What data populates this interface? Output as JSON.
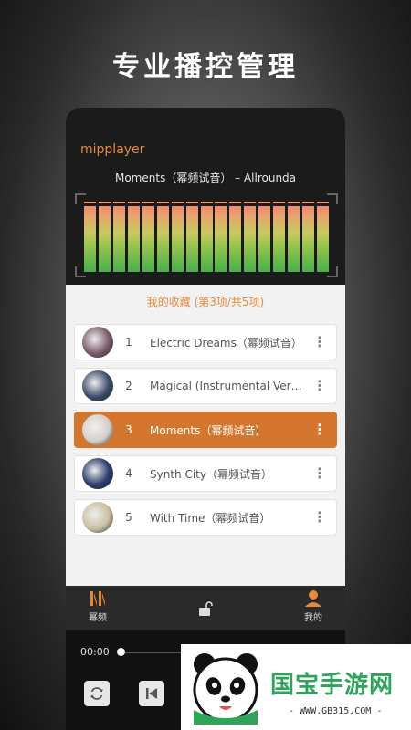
{
  "headline": "专业播控管理",
  "app": {
    "brand": "mipplayer",
    "now_playing": "Moments（幂频试音） – Allrounda"
  },
  "visualizer": {
    "levels": [
      0.92,
      0.92,
      0.92,
      0.92,
      0.92,
      0.92,
      0.92,
      0.92,
      0.92,
      0.92,
      0.92,
      0.92,
      0.92,
      0.92,
      0.92,
      0.92,
      0.92
    ]
  },
  "playlist": {
    "title": "我的收藏 (第3项/共5项)",
    "items": [
      {
        "num": "1",
        "name": "Electric Dreams（幂频试音）",
        "active": false,
        "thumb_color": "#7a5a6a"
      },
      {
        "num": "2",
        "name": "Magical (Instrumental Version)",
        "active": false,
        "thumb_color": "#3a4a6a"
      },
      {
        "num": "3",
        "name": "Moments（幂频试音）",
        "active": true,
        "thumb_color": "#d8d0c8"
      },
      {
        "num": "4",
        "name": "Synth City（幂频试音）",
        "active": false,
        "thumb_color": "#2a3a6a"
      },
      {
        "num": "5",
        "name": "With Time（幂频试音）",
        "active": false,
        "thumb_color": "#c8c0a0"
      }
    ]
  },
  "tabs": {
    "left": "幂频",
    "right": "我的"
  },
  "player": {
    "time": "00:00",
    "progress": 0.0
  },
  "watermark": {
    "text": "国宝手游网",
    "url": "- WWW.GB315.COM -"
  },
  "colors": {
    "accent": "#e58a3c",
    "active_row": "#d5762f"
  }
}
